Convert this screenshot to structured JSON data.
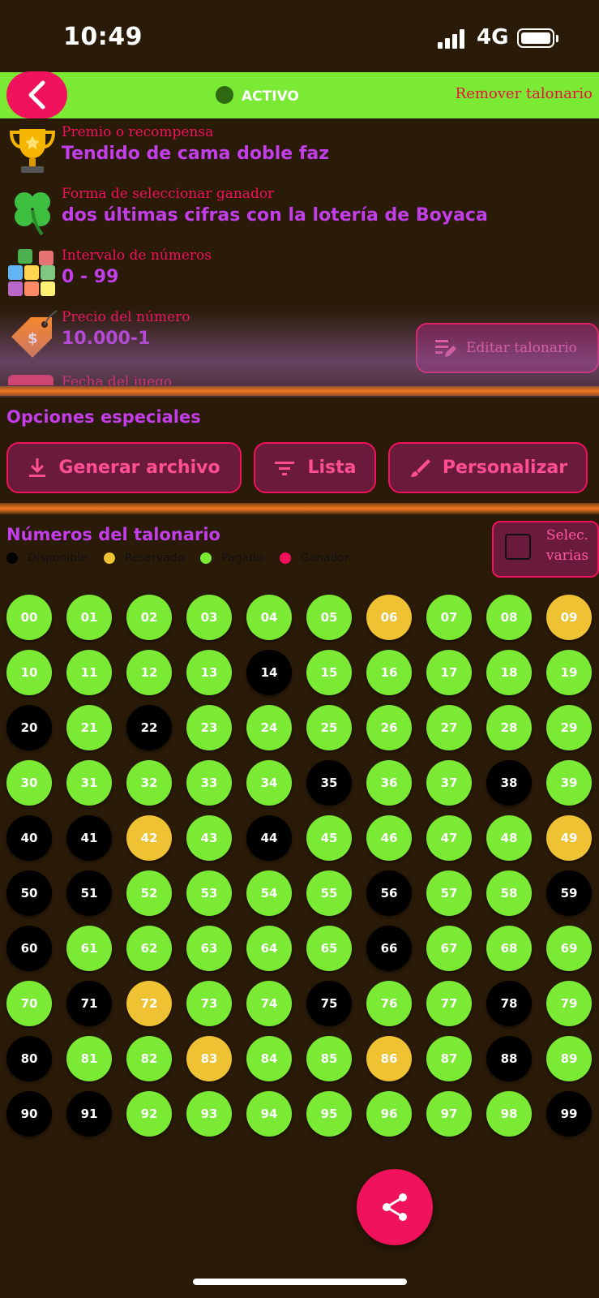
{
  "status_bar": {
    "time": "10:49",
    "network": "4G"
  },
  "header": {
    "status_label": "ACTIVO",
    "remove_label": "Remover talonario"
  },
  "info": [
    {
      "label": "Premio o recompensa",
      "value": "Tendido de cama doble faz",
      "icon": "trophy-icon"
    },
    {
      "label": "Forma de seleccionar ganador",
      "value": "dos últimas cifras con la lotería de Boyaca",
      "icon": "clover-icon"
    },
    {
      "label": "Intervalo de números",
      "value": "0 - 99",
      "icon": "number-blocks-icon"
    },
    {
      "label": "Precio del número",
      "value": "10.000-1",
      "icon": "price-tag-icon"
    },
    {
      "label": "Fecha del juego",
      "value": "",
      "icon": "calendar-icon"
    }
  ],
  "edit_label": "Editar talonario",
  "special": {
    "title": "Opciones especiales",
    "generate_label": "Generar archivo",
    "list_label": "Lista",
    "customize_label": "Personalizar"
  },
  "numbers_section": {
    "title": "Números del talonario",
    "multi_select_label": "Selec. varias",
    "legend": [
      {
        "label": "Disponible",
        "color": "#000000"
      },
      {
        "label": "Reservado",
        "color": "#efc234"
      },
      {
        "label": "Pagado",
        "color": "#7bea34"
      },
      {
        "label": "Ganador",
        "color": "#f0125c"
      }
    ]
  },
  "colors": {
    "accent": "#f0125c",
    "green": "#7bea34",
    "purple": "#c13ee8",
    "available": "#000000",
    "reserved": "#efc234",
    "paid": "#7bea34"
  },
  "numbers": [
    {
      "n": "00",
      "s": "paid"
    },
    {
      "n": "01",
      "s": "paid"
    },
    {
      "n": "02",
      "s": "paid"
    },
    {
      "n": "03",
      "s": "paid"
    },
    {
      "n": "04",
      "s": "paid"
    },
    {
      "n": "05",
      "s": "paid"
    },
    {
      "n": "06",
      "s": "reserved"
    },
    {
      "n": "07",
      "s": "paid"
    },
    {
      "n": "08",
      "s": "paid"
    },
    {
      "n": "09",
      "s": "reserved"
    },
    {
      "n": "10",
      "s": "paid"
    },
    {
      "n": "11",
      "s": "paid"
    },
    {
      "n": "12",
      "s": "paid"
    },
    {
      "n": "13",
      "s": "paid"
    },
    {
      "n": "14",
      "s": "available"
    },
    {
      "n": "15",
      "s": "paid"
    },
    {
      "n": "16",
      "s": "paid"
    },
    {
      "n": "17",
      "s": "paid"
    },
    {
      "n": "18",
      "s": "paid"
    },
    {
      "n": "19",
      "s": "paid"
    },
    {
      "n": "20",
      "s": "available"
    },
    {
      "n": "21",
      "s": "paid"
    },
    {
      "n": "22",
      "s": "available"
    },
    {
      "n": "23",
      "s": "paid"
    },
    {
      "n": "24",
      "s": "paid"
    },
    {
      "n": "25",
      "s": "paid"
    },
    {
      "n": "26",
      "s": "paid"
    },
    {
      "n": "27",
      "s": "paid"
    },
    {
      "n": "28",
      "s": "paid"
    },
    {
      "n": "29",
      "s": "paid"
    },
    {
      "n": "30",
      "s": "paid"
    },
    {
      "n": "31",
      "s": "paid"
    },
    {
      "n": "32",
      "s": "paid"
    },
    {
      "n": "33",
      "s": "paid"
    },
    {
      "n": "34",
      "s": "paid"
    },
    {
      "n": "35",
      "s": "available"
    },
    {
      "n": "36",
      "s": "paid"
    },
    {
      "n": "37",
      "s": "paid"
    },
    {
      "n": "38",
      "s": "available"
    },
    {
      "n": "39",
      "s": "paid"
    },
    {
      "n": "40",
      "s": "available"
    },
    {
      "n": "41",
      "s": "available"
    },
    {
      "n": "42",
      "s": "reserved"
    },
    {
      "n": "43",
      "s": "paid"
    },
    {
      "n": "44",
      "s": "available"
    },
    {
      "n": "45",
      "s": "paid"
    },
    {
      "n": "46",
      "s": "paid"
    },
    {
      "n": "47",
      "s": "paid"
    },
    {
      "n": "48",
      "s": "paid"
    },
    {
      "n": "49",
      "s": "reserved"
    },
    {
      "n": "50",
      "s": "available"
    },
    {
      "n": "51",
      "s": "available"
    },
    {
      "n": "52",
      "s": "paid"
    },
    {
      "n": "53",
      "s": "paid"
    },
    {
      "n": "54",
      "s": "paid"
    },
    {
      "n": "55",
      "s": "paid"
    },
    {
      "n": "56",
      "s": "available"
    },
    {
      "n": "57",
      "s": "paid"
    },
    {
      "n": "58",
      "s": "paid"
    },
    {
      "n": "59",
      "s": "available"
    },
    {
      "n": "60",
      "s": "available"
    },
    {
      "n": "61",
      "s": "paid"
    },
    {
      "n": "62",
      "s": "paid"
    },
    {
      "n": "63",
      "s": "paid"
    },
    {
      "n": "64",
      "s": "paid"
    },
    {
      "n": "65",
      "s": "paid"
    },
    {
      "n": "66",
      "s": "available"
    },
    {
      "n": "67",
      "s": "paid"
    },
    {
      "n": "68",
      "s": "paid"
    },
    {
      "n": "69",
      "s": "paid"
    },
    {
      "n": "70",
      "s": "paid"
    },
    {
      "n": "71",
      "s": "available"
    },
    {
      "n": "72",
      "s": "reserved"
    },
    {
      "n": "73",
      "s": "paid"
    },
    {
      "n": "74",
      "s": "paid"
    },
    {
      "n": "75",
      "s": "available"
    },
    {
      "n": "76",
      "s": "paid"
    },
    {
      "n": "77",
      "s": "paid"
    },
    {
      "n": "78",
      "s": "available"
    },
    {
      "n": "79",
      "s": "paid"
    },
    {
      "n": "80",
      "s": "available"
    },
    {
      "n": "81",
      "s": "paid"
    },
    {
      "n": "82",
      "s": "paid"
    },
    {
      "n": "83",
      "s": "reserved"
    },
    {
      "n": "84",
      "s": "paid"
    },
    {
      "n": "85",
      "s": "paid"
    },
    {
      "n": "86",
      "s": "reserved"
    },
    {
      "n": "87",
      "s": "paid"
    },
    {
      "n": "88",
      "s": "available"
    },
    {
      "n": "89",
      "s": "paid"
    },
    {
      "n": "90",
      "s": "available"
    },
    {
      "n": "91",
      "s": "available"
    },
    {
      "n": "92",
      "s": "paid"
    },
    {
      "n": "93",
      "s": "paid"
    },
    {
      "n": "94",
      "s": "paid"
    },
    {
      "n": "95",
      "s": "paid"
    },
    {
      "n": "96",
      "s": "paid"
    },
    {
      "n": "97",
      "s": "paid"
    },
    {
      "n": "98",
      "s": "paid"
    },
    {
      "n": "99",
      "s": "available"
    }
  ]
}
